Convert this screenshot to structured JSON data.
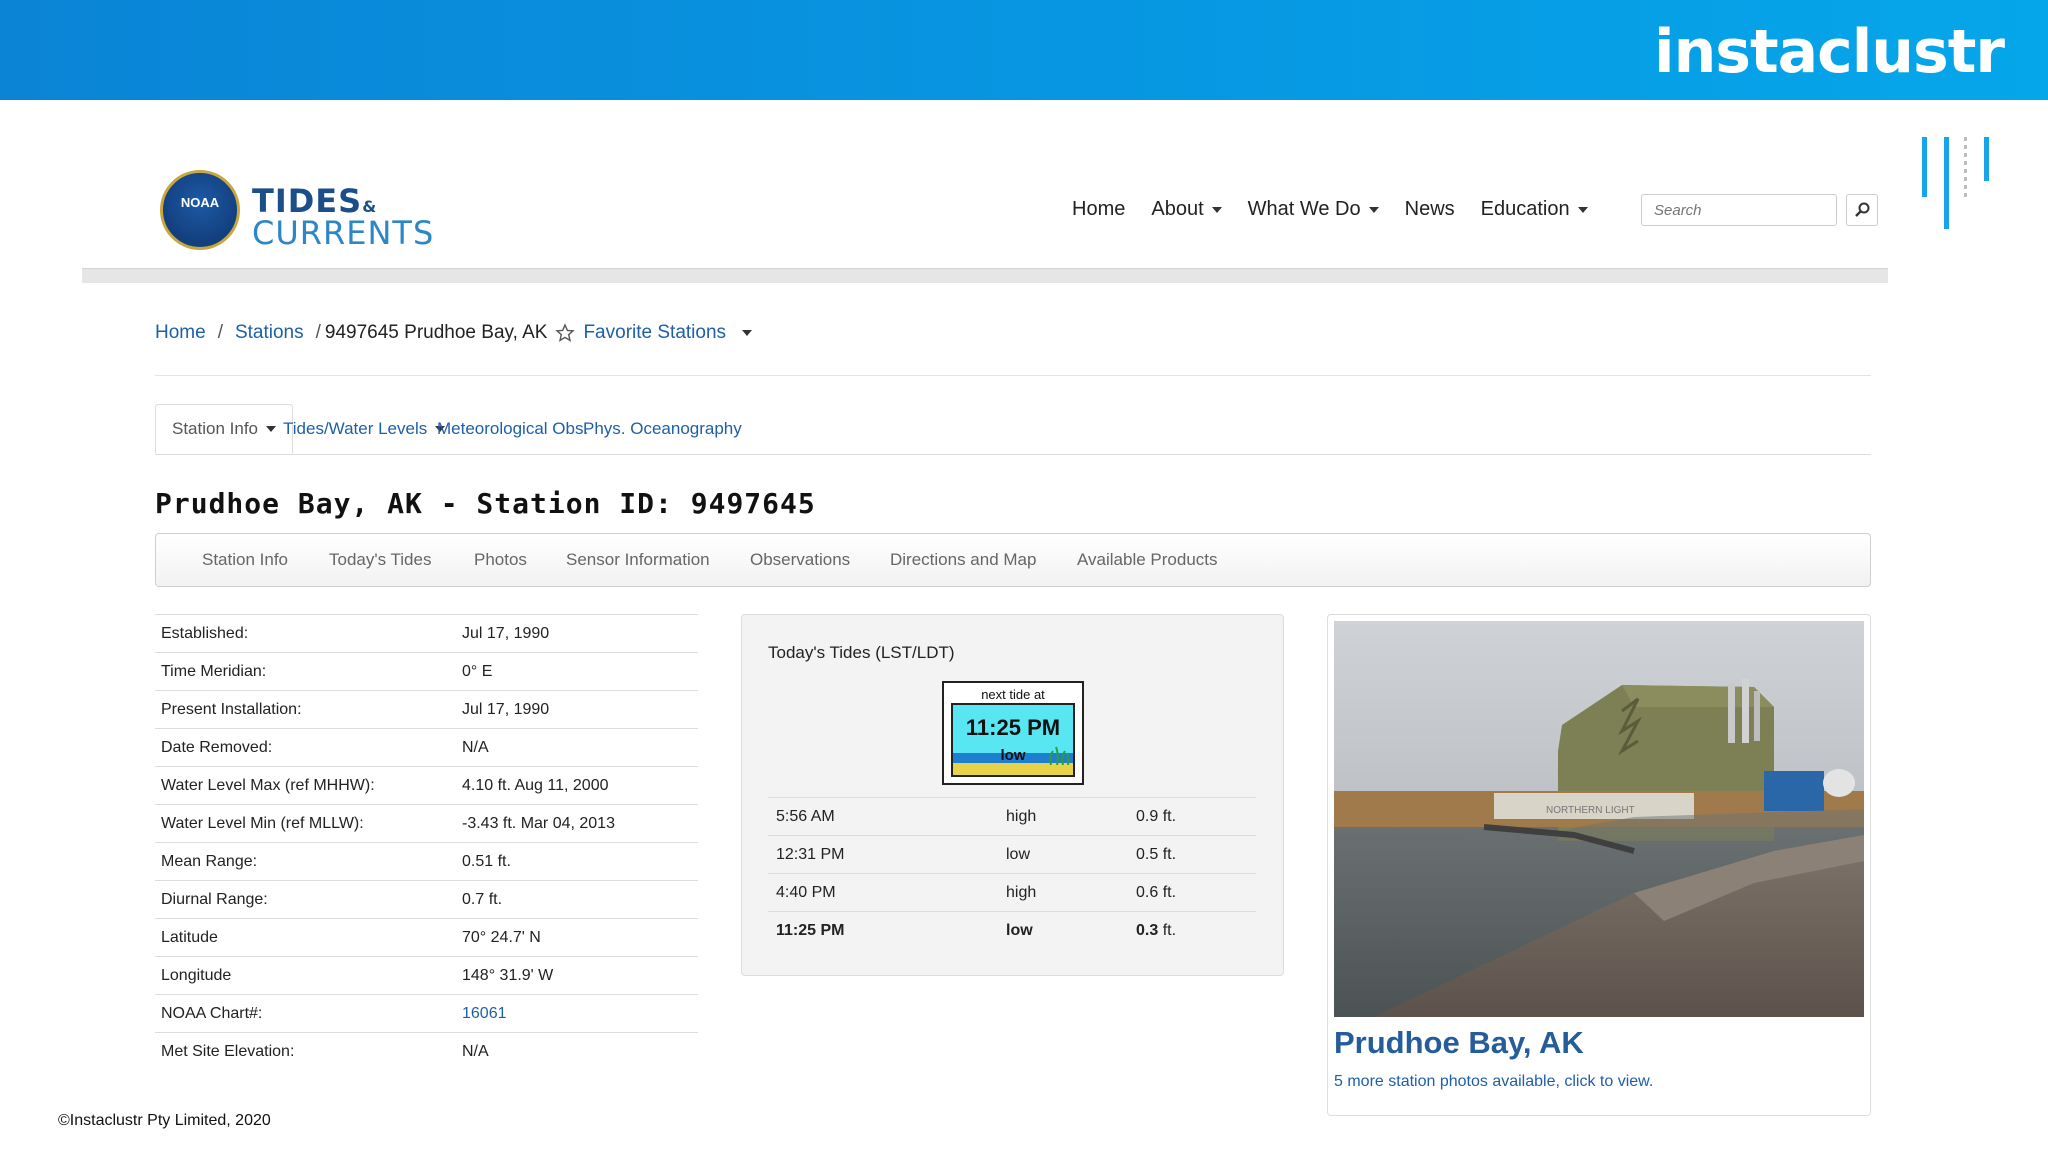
{
  "banner": {
    "brand": "instaclustr"
  },
  "site": {
    "logo": {
      "seal_text": "NOAA",
      "line1": "TIDES",
      "amp": "&",
      "line2": "CURRENTS"
    },
    "nav": [
      {
        "label": "Home",
        "dropdown": false
      },
      {
        "label": "About",
        "dropdown": true
      },
      {
        "label": "What We Do",
        "dropdown": true
      },
      {
        "label": "News",
        "dropdown": false
      },
      {
        "label": "Education",
        "dropdown": true
      }
    ],
    "search": {
      "placeholder": "Search"
    }
  },
  "breadcrumb": {
    "home": "Home",
    "stations": "Stations",
    "current": "9497645 Prudhoe Bay, AK",
    "favorites": "Favorite Stations"
  },
  "tabs": [
    {
      "label": "Station Info",
      "active": true,
      "dropdown": true
    },
    {
      "label": "Tides/Water Levels",
      "active": false,
      "dropdown": true
    },
    {
      "label": "Meteorological Obs.",
      "active": false,
      "dropdown": false
    },
    {
      "label": "Phys. Oceanography",
      "active": false,
      "dropdown": false
    }
  ],
  "station_title": "Prudhoe Bay, AK - Station ID: 9497645",
  "subnav": [
    "Station Info",
    "Today's Tides",
    "Photos",
    "Sensor Information",
    "Observations",
    "Directions and Map",
    "Available Products"
  ],
  "station_info": [
    {
      "label": "Established:",
      "value": "Jul 17, 1990"
    },
    {
      "label": "Time Meridian:",
      "value": "0° E"
    },
    {
      "label": "Present Installation:",
      "value": "Jul 17, 1990"
    },
    {
      "label": "Date Removed:",
      "value": "N/A"
    },
    {
      "label": "Water Level Max (ref MHHW):",
      "value": "4.10 ft. Aug 11, 2000"
    },
    {
      "label": "Water Level Min (ref MLLW):",
      "value": "-3.43 ft. Mar 04, 2013"
    },
    {
      "label": "Mean Range:",
      "value": "0.51 ft."
    },
    {
      "label": "Diurnal Range:",
      "value": "0.7 ft."
    },
    {
      "label": "Latitude",
      "value": "70° 24.7' N"
    },
    {
      "label": "Longitude",
      "value": "148° 31.9' W"
    },
    {
      "label": "NOAA Chart#:",
      "value": "16061",
      "link": true
    },
    {
      "label": "Met Site Elevation:",
      "value": "N/A"
    }
  ],
  "todays_tides": {
    "heading": "Today's Tides (LST/LDT)",
    "widget": {
      "label": "next tide at",
      "time": "11:25 PM",
      "state": "low"
    },
    "rows": [
      {
        "time": "5:56 AM",
        "type": "high",
        "height": "0.9",
        "unit": " ft.",
        "bold": false
      },
      {
        "time": "12:31 PM",
        "type": "low",
        "height": "0.5",
        "unit": " ft.",
        "bold": false
      },
      {
        "time": "4:40 PM",
        "type": "high",
        "height": "0.6",
        "unit": " ft.",
        "bold": false
      },
      {
        "time": "11:25 PM",
        "type": "low",
        "height": "0.3",
        "unit": " ft.",
        "bold": true
      }
    ]
  },
  "photo": {
    "title": "Prudhoe Bay, AK",
    "more": "5 more station photos available, click to view.",
    "building_sign": "NORTHERN LIGHT"
  },
  "footer": {
    "copyright": "©Instaclustr Pty Limited, 2020"
  },
  "colors": {
    "banner": "#0797e2",
    "link": "#1e5fa8",
    "photo_title": "#245d9a"
  }
}
